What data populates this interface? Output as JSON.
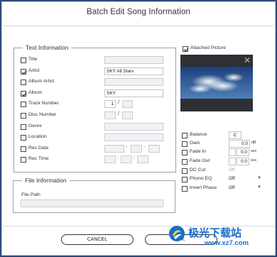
{
  "window": {
    "title": "Batch Edit Song Information"
  },
  "text_info": {
    "group_title": "Text Information",
    "rows": [
      {
        "label": "Title",
        "checked": false,
        "value": ""
      },
      {
        "label": "Artist",
        "checked": true,
        "value": "SKY All Stars"
      },
      {
        "label": "Album Artist",
        "checked": false,
        "value": ""
      },
      {
        "label": "Album",
        "checked": true,
        "value": "SKY"
      },
      {
        "label": "Track Number",
        "checked": false,
        "value": "1",
        "value2": ""
      },
      {
        "label": "Disc Number",
        "checked": false,
        "value": "",
        "value2": ""
      },
      {
        "label": "Genre",
        "checked": false,
        "value": ""
      },
      {
        "label": "Location",
        "checked": false,
        "value": ""
      },
      {
        "label": "Rec Date",
        "checked": false
      },
      {
        "label": "Rec Time",
        "checked": false
      }
    ],
    "separators": {
      "slash": "/",
      "dash": "-",
      "colon": ":"
    }
  },
  "file_info": {
    "group_title": "File Information",
    "path_label": "File Path",
    "path_value": ""
  },
  "picture": {
    "label": "Attached Picture",
    "checked": true
  },
  "audio": {
    "balance": {
      "label": "Balance",
      "value": "C"
    },
    "gain": {
      "label": "Gain",
      "value": "0.0",
      "unit": "dB"
    },
    "fade_in": {
      "label": "Fade In",
      "value": "0.0",
      "unit": "sec"
    },
    "fade_out": {
      "label": "Fade Out",
      "value": "0.0",
      "unit": "sec"
    },
    "dc_cut": {
      "label": "DC Cut",
      "value": "Off"
    },
    "phono_eq": {
      "label": "Phono EQ",
      "value": "Off"
    },
    "invert_phase": {
      "label": "Invert Phase",
      "value": "Off"
    }
  },
  "buttons": {
    "cancel": "CANCEL",
    "ok": "OK"
  },
  "watermark": {
    "brand": "极光下载站",
    "url": "www.xz7.com"
  }
}
